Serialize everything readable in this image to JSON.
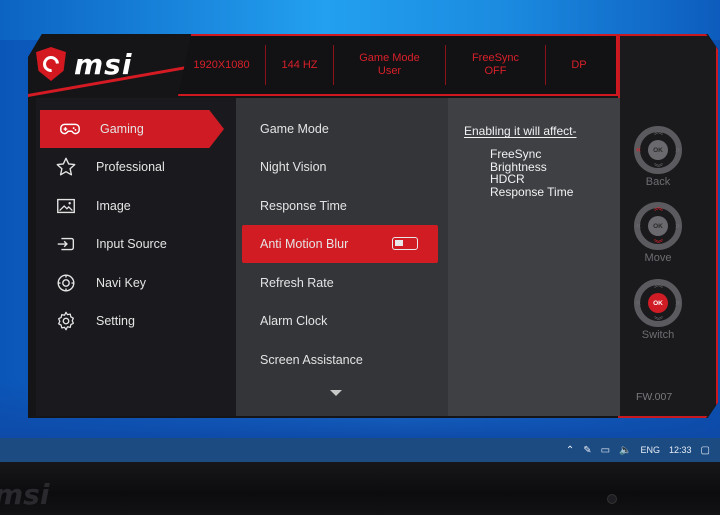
{
  "brand": {
    "logo_text": "msi"
  },
  "status": [
    {
      "line1": "1920X1080",
      "line2": ""
    },
    {
      "line1": "144 HZ",
      "line2": ""
    },
    {
      "line1": "Game Mode",
      "line2": "User"
    },
    {
      "line1": "FreeSync",
      "line2": "OFF"
    },
    {
      "line1": "DP",
      "line2": ""
    }
  ],
  "nav": [
    {
      "label": "Gaming",
      "icon": "gamepad-icon",
      "active": true
    },
    {
      "label": "Professional",
      "icon": "star-icon",
      "active": false
    },
    {
      "label": "Image",
      "icon": "image-icon",
      "active": false
    },
    {
      "label": "Input Source",
      "icon": "input-source-icon",
      "active": false
    },
    {
      "label": "Navi Key",
      "icon": "navi-key-icon",
      "active": false
    },
    {
      "label": "Setting",
      "icon": "settings-gear-icon",
      "active": false
    }
  ],
  "menu": [
    {
      "label": "Game Mode"
    },
    {
      "label": "Night Vision"
    },
    {
      "label": "Response Time"
    },
    {
      "label": "Anti Motion Blur",
      "active": true,
      "toggle": "off"
    },
    {
      "label": "Refresh Rate"
    },
    {
      "label": "Alarm Clock"
    },
    {
      "label": "Screen Assistance"
    }
  ],
  "info": {
    "title": "Enabling it will affect-",
    "items": [
      "FreeSync",
      "Brightness",
      "HDCR",
      "Response Time"
    ]
  },
  "keys": [
    {
      "label": "Back",
      "center": "OK"
    },
    {
      "label": "Move",
      "center": "OK"
    },
    {
      "label": "Switch",
      "center": "OK"
    }
  ],
  "firmware": "FW.007",
  "taskbar": {
    "language": "ENG",
    "time": "12:33"
  },
  "colors": {
    "accent": "#d11c24",
    "panel_dark": "#1a1a1e",
    "panel_mid": "#333539",
    "panel_light": "#3e4044"
  }
}
